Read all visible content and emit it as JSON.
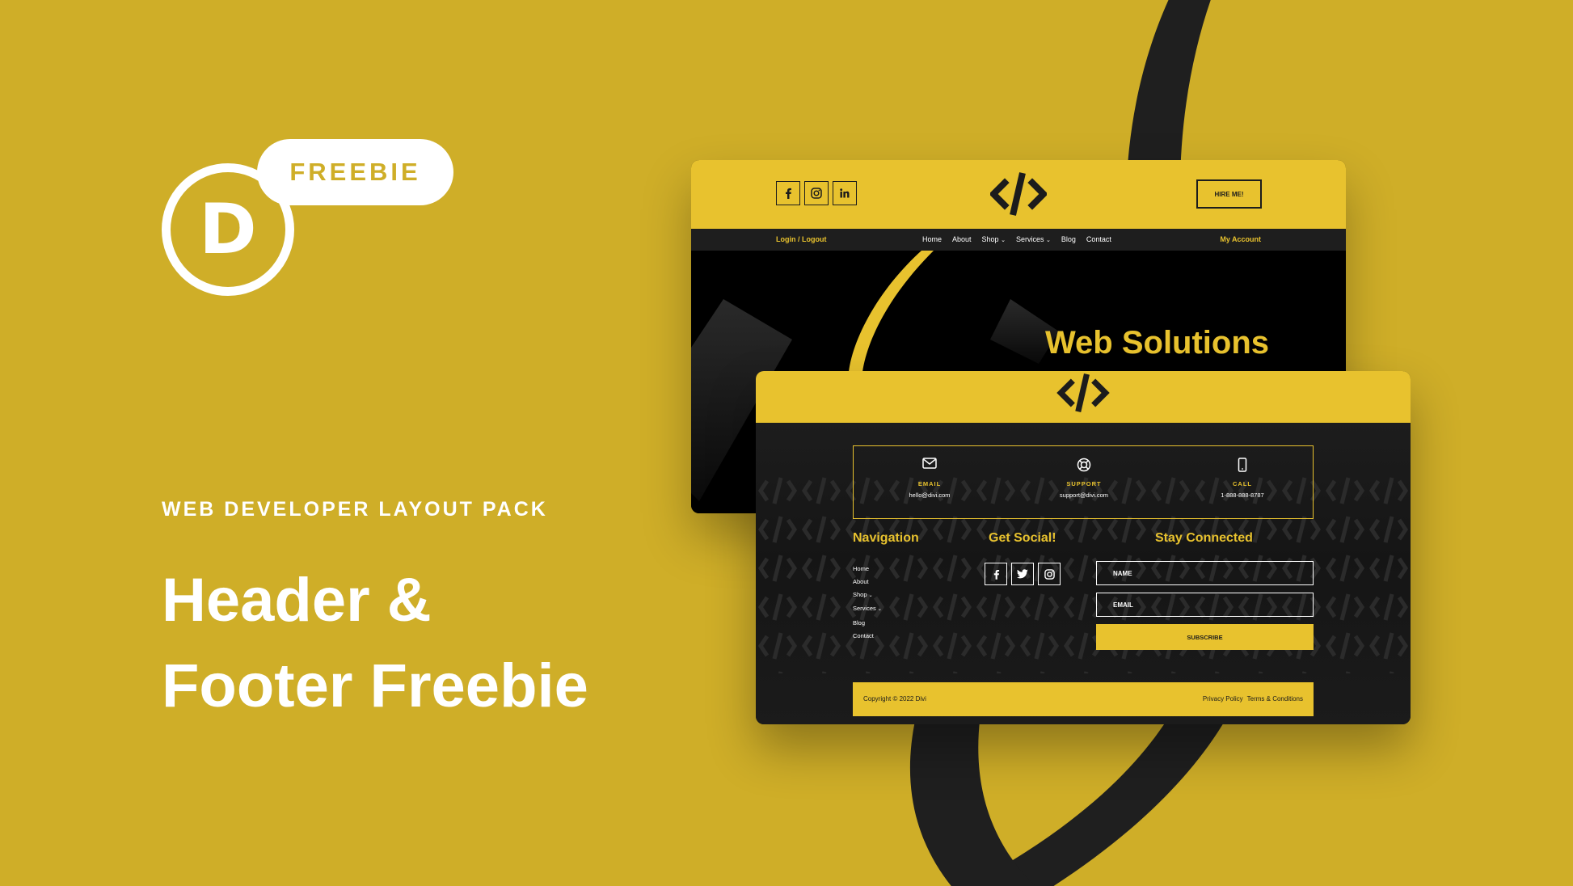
{
  "promo": {
    "badge": "FREEBIE",
    "logo_letter": "D",
    "kicker": "WEB DEVELOPER LAYOUT PACK",
    "headline_line1": "Header &",
    "headline_line2": "Footer Freebie"
  },
  "header_mock": {
    "social": [
      "f",
      "ig",
      "in"
    ],
    "hire_label": "HIRE ME!",
    "login_label": "Login / Logout",
    "account_label": "My Account",
    "nav_items": [
      "Home",
      "About",
      "Shop",
      "Services",
      "Blog",
      "Contact"
    ],
    "hero_title": "Web Solutions"
  },
  "footer_mock": {
    "contacts": [
      {
        "icon": "envelope-icon",
        "label": "EMAIL",
        "value": "hello@divi.com"
      },
      {
        "icon": "lifebuoy-icon",
        "label": "SUPPORT",
        "value": "support@divi.com"
      },
      {
        "icon": "phone-icon",
        "label": "CALL",
        "value": "1-888-888-8787"
      }
    ],
    "nav_title": "Navigation",
    "nav_items": [
      "Home",
      "About",
      "Shop",
      "Services",
      "Blog",
      "Contact"
    ],
    "social_title": "Get Social!",
    "social": [
      "facebook-icon",
      "twitter-icon",
      "instagram-icon"
    ],
    "connect_title": "Stay Connected",
    "name_placeholder": "NAME",
    "email_placeholder": "EMAIL",
    "subscribe_label": "SUBSCRIBE",
    "copyright": "Copyright © 2022 Divi",
    "privacy": "Privacy Policy",
    "terms": "Terms & Conditions"
  },
  "colors": {
    "background": "#CFAE28",
    "accent": "#E8C22E",
    "dark": "#1d1d1d"
  }
}
